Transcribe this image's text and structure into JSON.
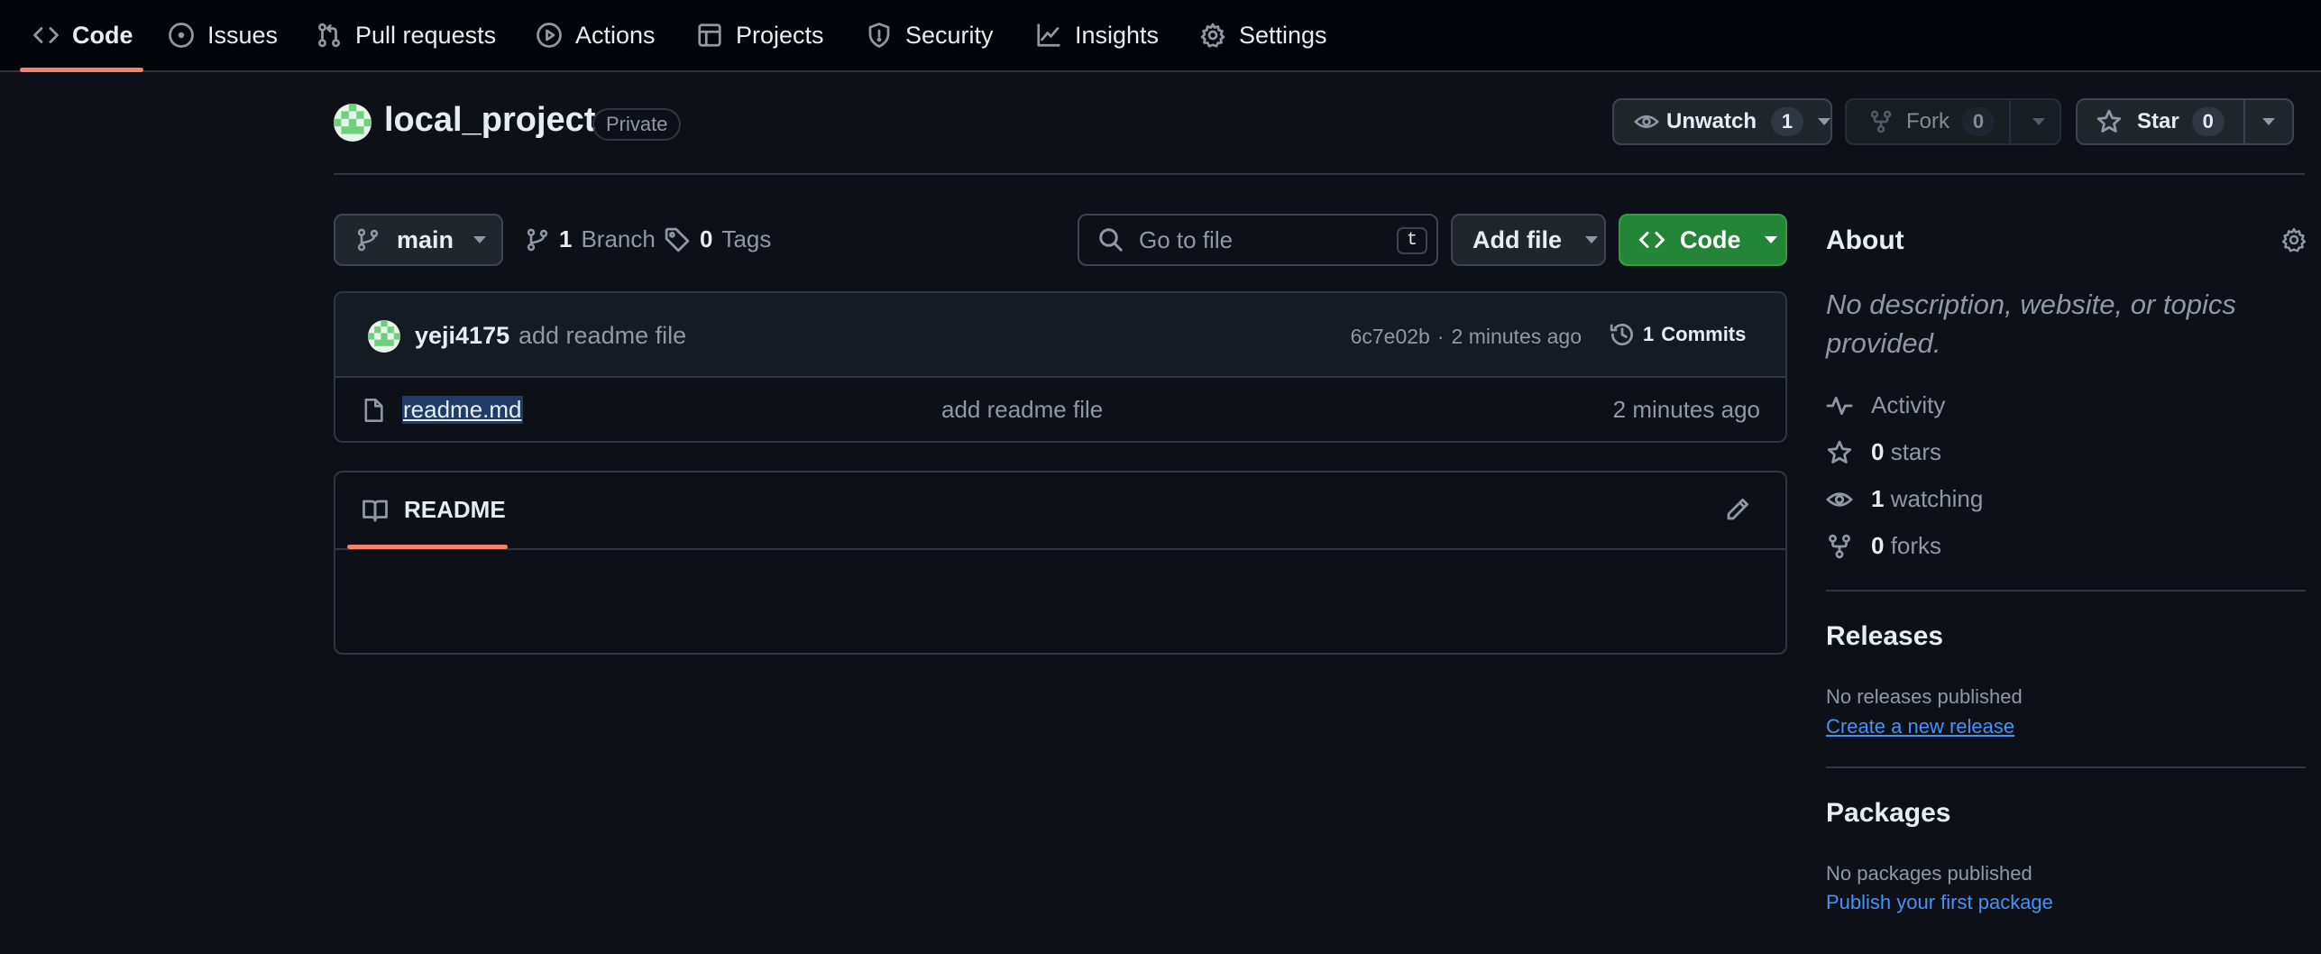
{
  "nav": {
    "tabs": [
      {
        "label": "Code",
        "icon": "code-icon"
      },
      {
        "label": "Issues",
        "icon": "issue-opened-icon"
      },
      {
        "label": "Pull requests",
        "icon": "git-pull-request-icon"
      },
      {
        "label": "Actions",
        "icon": "play-icon"
      },
      {
        "label": "Projects",
        "icon": "table-icon"
      },
      {
        "label": "Security",
        "icon": "shield-icon"
      },
      {
        "label": "Insights",
        "icon": "graph-icon"
      },
      {
        "label": "Settings",
        "icon": "gear-icon"
      }
    ],
    "active_tab": "Code",
    "accent_color": "#f78166"
  },
  "repo": {
    "name": "local_project",
    "visibility": "Private",
    "watch": {
      "label": "Unwatch",
      "count": "1"
    },
    "fork": {
      "label": "Fork",
      "count": "0"
    },
    "star": {
      "label": "Star",
      "count": "0"
    }
  },
  "toolbar": {
    "branch": "main",
    "branch_count": "1",
    "branch_label": "Branch",
    "tag_count": "0",
    "tag_label": "Tags",
    "search_placeholder": "Go to file",
    "search_shortcut": "t",
    "add_file_label": "Add file",
    "code_label": "Code",
    "code_button_color": "#238636"
  },
  "latest_commit": {
    "author": "yeji4175",
    "message": "add readme file",
    "hash": "6c7e02b",
    "separator": "·",
    "time": "2 minutes ago",
    "commits_count": "1",
    "commits_label": "Commits"
  },
  "files": [
    {
      "name": "readme.md",
      "message": "add readme file",
      "time": "2 minutes ago",
      "icon": "file-icon"
    }
  ],
  "readme": {
    "tab_label": "README"
  },
  "about": {
    "heading": "About",
    "description": "No description, website, or topics provided.",
    "activity_label": "Activity",
    "stars_count": "0",
    "stars_label": "stars",
    "watching_count": "1",
    "watching_label": "watching",
    "forks_count": "0",
    "forks_label": "forks"
  },
  "releases": {
    "heading": "Releases",
    "empty_text": "No releases published",
    "link": "Create a new release"
  },
  "packages": {
    "heading": "Packages",
    "empty_text": "No packages published",
    "link": "Publish your first package"
  },
  "colors": {
    "background": "#0d1117",
    "link": "#4493f8",
    "selection": "#1f3b67"
  }
}
